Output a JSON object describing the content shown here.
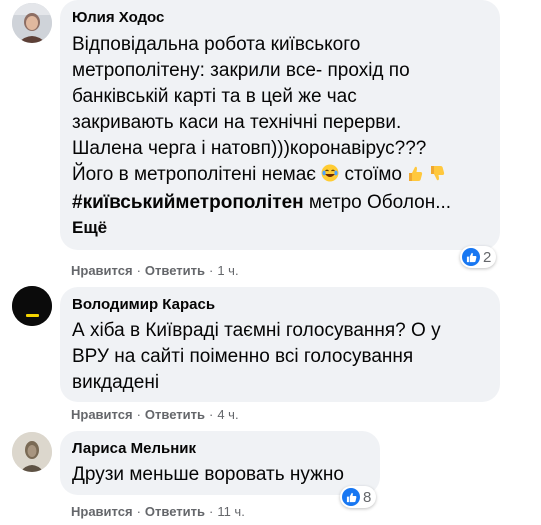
{
  "comments": [
    {
      "author": "Юлия Ходос",
      "lines": [
        "Відповідальна робота київського",
        "метрополітену: закрили все- прохід по",
        "банківській карті та в цей же час",
        "закривають каси на технічні перерви.",
        "Шалена черга і натовп)))коронавірус???",
        "Його в метрополітені немає",
        "стоїмо"
      ],
      "hashtag": "#київськийметрополітен",
      "tail": "метро Оболон...",
      "more_label": "Ещё",
      "like_label": "Нравится",
      "reply_label": "Ответить",
      "time": "1 ч.",
      "reaction_count": "2"
    },
    {
      "author": "Володимир Карась",
      "lines": [
        "А хіба в Київраді таємні голосування? О у",
        "ВРУ на сайті поіменно всі голосування",
        "викдадені"
      ],
      "like_label": "Нравится",
      "reply_label": "Ответить",
      "time": "4 ч."
    },
    {
      "author": "Лариса Мельник",
      "lines": [
        "Друзи меньше воровать нужно"
      ],
      "like_label": "Нравится",
      "reply_label": "Ответить",
      "time": "11 ч.",
      "reaction_count": "8"
    }
  ],
  "colors": {
    "bubble": "#f0f2f5",
    "meta_text": "#65676b",
    "like_blue": "#1877f2"
  },
  "icons": {
    "laugh": "laughing-emoji",
    "thumbs_up": "thumbs-up-emoji",
    "thumbs_down": "thumbs-down-emoji",
    "like": "like-icon"
  }
}
